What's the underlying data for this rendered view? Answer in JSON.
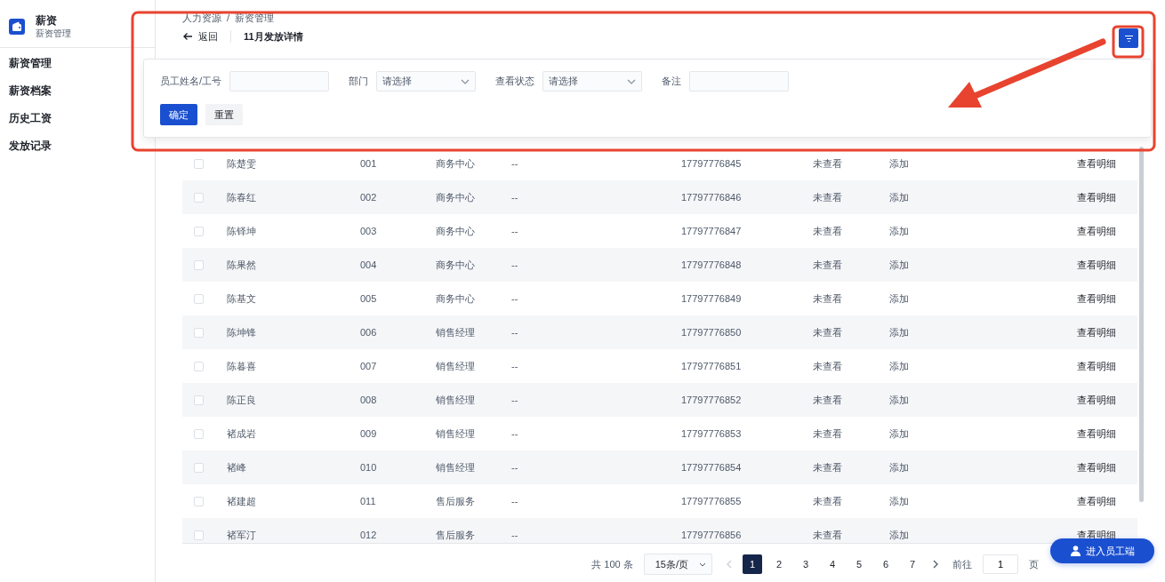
{
  "sidebar": {
    "app_title": "薪资",
    "app_subtitle": "薪资管理",
    "items": [
      {
        "label": "薪资管理"
      },
      {
        "label": "薪资档案"
      },
      {
        "label": "历史工资"
      },
      {
        "label": "发放记录"
      }
    ]
  },
  "breadcrumb": [
    "人力资源",
    "/",
    "薪资管理"
  ],
  "back_label": "返回",
  "page_title": "11月发放详情",
  "filter_panel": {
    "fields": [
      {
        "kind": "text",
        "label": "员工姓名/工号"
      },
      {
        "kind": "select",
        "label": "部门",
        "placeholder": "请选择"
      },
      {
        "kind": "select",
        "label": "查看状态",
        "placeholder": "请选择"
      },
      {
        "kind": "text",
        "label": "备注"
      }
    ],
    "buttons": [
      {
        "label": "确定",
        "kind": "primary"
      },
      {
        "label": "重置",
        "kind": "plain"
      }
    ]
  },
  "table": {
    "rows": [
      {
        "checked": false,
        "name": "陈楚雯",
        "number": "001",
        "department": "商务中心",
        "column_4": "--",
        "phone": "17797776845",
        "status": "未查看",
        "column_7": "添加",
        "action": "查看明细"
      },
      {
        "checked": false,
        "name": "陈春红",
        "number": "002",
        "department": "商务中心",
        "column_4": "--",
        "phone": "17797776846",
        "status": "未查看",
        "column_7": "添加",
        "action": "查看明细"
      },
      {
        "checked": false,
        "name": "陈铎坤",
        "number": "003",
        "department": "商务中心",
        "column_4": "--",
        "phone": "17797776847",
        "status": "未查看",
        "column_7": "添加",
        "action": "查看明细"
      },
      {
        "checked": false,
        "name": "陈果然",
        "number": "004",
        "department": "商务中心",
        "column_4": "--",
        "phone": "17797776848",
        "status": "未查看",
        "column_7": "添加",
        "action": "查看明细"
      },
      {
        "checked": false,
        "name": "陈基文",
        "number": "005",
        "department": "商务中心",
        "column_4": "--",
        "phone": "17797776849",
        "status": "未查看",
        "column_7": "添加",
        "action": "查看明细"
      },
      {
        "checked": false,
        "name": "陈坤锋",
        "number": "006",
        "department": "销售经理",
        "column_4": "--",
        "phone": "17797776850",
        "status": "未查看",
        "column_7": "添加",
        "action": "查看明细"
      },
      {
        "checked": false,
        "name": "陈暮喜",
        "number": "007",
        "department": "销售经理",
        "column_4": "--",
        "phone": "17797776851",
        "status": "未查看",
        "column_7": "添加",
        "action": "查看明细"
      },
      {
        "checked": false,
        "name": "陈正良",
        "number": "008",
        "department": "销售经理",
        "column_4": "--",
        "phone": "17797776852",
        "status": "未查看",
        "column_7": "添加",
        "action": "查看明细"
      },
      {
        "checked": false,
        "name": "褚成岩",
        "number": "009",
        "department": "销售经理",
        "column_4": "--",
        "phone": "17797776853",
        "status": "未查看",
        "column_7": "添加",
        "action": "查看明细"
      },
      {
        "checked": false,
        "name": "褚峰",
        "number": "010",
        "department": "销售经理",
        "column_4": "--",
        "phone": "17797776854",
        "status": "未查看",
        "column_7": "添加",
        "action": "查看明细"
      },
      {
        "checked": false,
        "name": "褚建超",
        "number": "011",
        "department": "售后服务",
        "column_4": "--",
        "phone": "17797776855",
        "status": "未查看",
        "column_7": "添加",
        "action": "查看明细"
      },
      {
        "checked": false,
        "name": "褚军汀",
        "number": "012",
        "department": "售后服务",
        "column_4": "--",
        "phone": "17797776856",
        "status": "未查看",
        "column_7": "添加",
        "action": "查看明细"
      }
    ]
  },
  "pagination": {
    "total": "共 100 条",
    "page_size": "15条/页",
    "pages": [
      {
        "label": "1",
        "selected": true
      },
      {
        "label": "2",
        "selected": false
      },
      {
        "label": "3",
        "selected": false
      },
      {
        "label": "4",
        "selected": false
      },
      {
        "label": "5",
        "selected": false
      },
      {
        "label": "6",
        "selected": false
      },
      {
        "label": "7",
        "selected": false
      }
    ],
    "goto_label": "前往",
    "goto_value": "1",
    "goto_suffix": "页"
  },
  "float_button": {
    "label": "进入员工端"
  },
  "annotations": [
    {
      "kind": "frame"
    },
    {
      "kind": "frame"
    },
    {
      "kind": "arrow"
    }
  ]
}
